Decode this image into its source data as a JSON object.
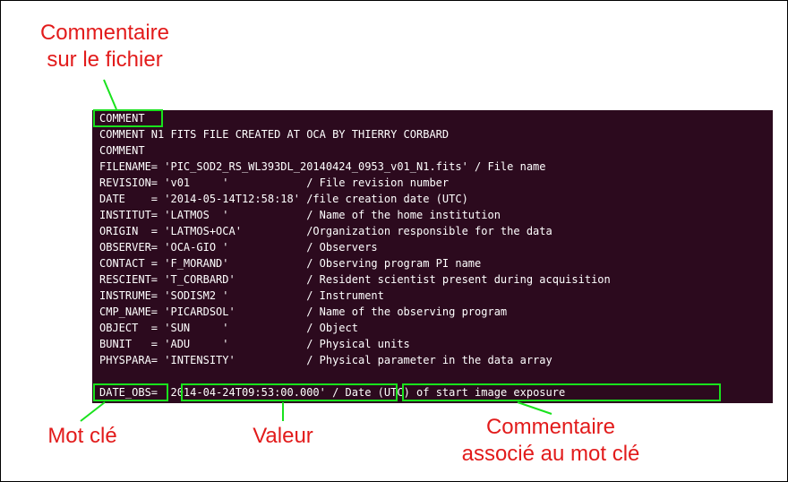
{
  "annotations": {
    "file_comment": [
      "Commentaire",
      "sur le fichier"
    ],
    "keyword": "Mot clé",
    "value": "Valeur",
    "keyword_comment": [
      "Commentaire",
      "associé au mot clé"
    ]
  },
  "header_lines": [
    "COMMENT",
    "COMMENT N1 FITS FILE CREATED AT OCA BY THIERRY CORBARD",
    "COMMENT",
    "FILENAME= 'PIC_SOD2_RS_WL393DL_20140424_0953_v01_N1.fits' / File name",
    "REVISION= 'v01     '            / File revision number",
    "DATE    = '2014-05-14T12:58:18' /file creation date (UTC)",
    "INSTITUT= 'LATMOS  '            / Name of the home institution",
    "ORIGIN  = 'LATMOS+OCA'          /Organization responsible for the data",
    "OBSERVER= 'OCA-GIO '            / Observers",
    "CONTACT = 'F_MORAND'            / Observing program PI name",
    "RESCIENT= 'T_CORBARD'           / Resident scientist present during acquisition",
    "INSTRUME= 'SODISM2 '            / Instrument",
    "CMP_NAME= 'PICARDSOL'           / Name of the observing program",
    "OBJECT  = 'SUN     '            / Object",
    "BUNIT   = 'ADU     '            / Physical units",
    "PHYSPARA= 'INTENSITY'           / Physical parameter in the data array"
  ],
  "last_line": {
    "keyword": "DATE_OBS",
    "separator": "= ",
    "value": "'2014-04-24T09:53:00.000'",
    "spacer": " ",
    "comment": "/ Date (UTC) of start image exposure"
  },
  "colors": {
    "terminal_background": "#2c0a1e",
    "terminal_text": "#ffffff",
    "annotation_text": "#e21b1b",
    "highlight_box": "#19e21d"
  }
}
